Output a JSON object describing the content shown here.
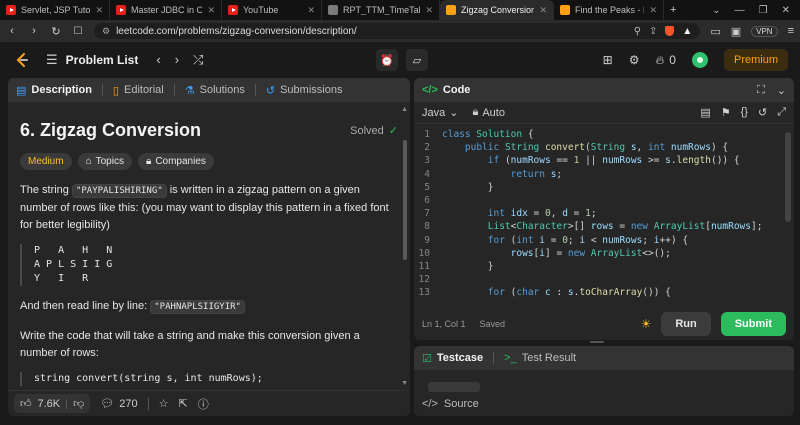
{
  "browser": {
    "tabs": [
      {
        "label": "Servlet, JSP Tutorial - YouTube",
        "favicon": "youtube-icon"
      },
      {
        "label": "Master JDBC in One Shot 🚀 : C",
        "favicon": "youtube-icon"
      },
      {
        "label": "YouTube",
        "favicon": "youtube-icon"
      },
      {
        "label": "RPT_TTM_TimeTableTran_Stude",
        "favicon": "web-icon"
      },
      {
        "label": "Zigzag Conversion - LeetC",
        "favicon": "leetcode-icon",
        "active": true
      },
      {
        "label": "Find the Peaks - LeetCode",
        "favicon": "leetcode-icon"
      }
    ],
    "new_tab": "+",
    "url": "leetcode.com/problems/zigzag-conversion/description/",
    "vpn_label": "VPN"
  },
  "header": {
    "problem_list_label": "Problem List",
    "streak_count": "0",
    "premium_label": "Premium"
  },
  "left_tabs": {
    "description": "Description",
    "editorial": "Editorial",
    "solutions": "Solutions",
    "submissions": "Submissions"
  },
  "problem": {
    "title": "6. Zigzag Conversion",
    "status": "Solved",
    "difficulty": "Medium",
    "topics_label": "Topics",
    "companies_label": "Companies",
    "para1_pre": "The string ",
    "para1_code": "\"PAYPALISHIRING\"",
    "para1_post": " is written in a zigzag pattern on a given number of rows like this: (you may want to display this pattern in a fixed font for better legibility)",
    "pattern": "P   A   H   N\nA P L S I I G\nY   I   R",
    "para2_pre": "And then read line by line: ",
    "para2_code": "\"PAHNAPLSIIGYIR\"",
    "para3": "Write the code that will take a string and make this conversion given a number of rows:",
    "signature": "string convert(string s, int numRows);"
  },
  "footer": {
    "likes": "7.6K",
    "comments": "270"
  },
  "code_panel": {
    "title": "Code",
    "language": "Java",
    "mode": "Auto",
    "cursor": "Ln 1, Col 1",
    "save_state": "Saved",
    "run_label": "Run",
    "submit_label": "Submit"
  },
  "code_lines": [
    {
      "n": "1",
      "indent": 0,
      "tokens": [
        [
          "kw",
          "class "
        ],
        [
          "ty",
          "Solution"
        ],
        [
          "",
          " {"
        ]
      ]
    },
    {
      "n": "2",
      "indent": 1,
      "tokens": [
        [
          "kw",
          "public "
        ],
        [
          "ty",
          "String "
        ],
        [
          "fn",
          "convert"
        ],
        [
          "",
          "("
        ],
        [
          "ty",
          "String "
        ],
        [
          "vr",
          "s"
        ],
        [
          "",
          ", "
        ],
        [
          "kw",
          "int "
        ],
        [
          "vr",
          "numRows"
        ],
        [
          "",
          ") {"
        ]
      ]
    },
    {
      "n": "3",
      "indent": 2,
      "tokens": [
        [
          "kw",
          "if "
        ],
        [
          "",
          "("
        ],
        [
          "vr",
          "numRows"
        ],
        [
          "",
          " == "
        ],
        [
          "nm",
          "1"
        ],
        [
          "",
          " || "
        ],
        [
          "vr",
          "numRows"
        ],
        [
          "",
          " >= "
        ],
        [
          "vr",
          "s"
        ],
        [
          "",
          "."
        ],
        [
          "fn",
          "length"
        ],
        [
          "",
          "()) {"
        ]
      ]
    },
    {
      "n": "4",
      "indent": 3,
      "tokens": [
        [
          "kw",
          "return "
        ],
        [
          "vr",
          "s"
        ],
        [
          "",
          ";"
        ]
      ]
    },
    {
      "n": "5",
      "indent": 2,
      "tokens": [
        [
          "",
          "}"
        ]
      ]
    },
    {
      "n": "6",
      "indent": 0,
      "tokens": []
    },
    {
      "n": "7",
      "indent": 2,
      "tokens": [
        [
          "kw",
          "int "
        ],
        [
          "vr",
          "idx"
        ],
        [
          "",
          " = "
        ],
        [
          "nm",
          "0"
        ],
        [
          "",
          ", "
        ],
        [
          "vr",
          "d"
        ],
        [
          "",
          " = "
        ],
        [
          "nm",
          "1"
        ],
        [
          "",
          ";"
        ]
      ]
    },
    {
      "n": "8",
      "indent": 2,
      "tokens": [
        [
          "ty",
          "List"
        ],
        [
          "",
          "<"
        ],
        [
          "ty",
          "Character"
        ],
        [
          "",
          ">[] "
        ],
        [
          "vr",
          "rows"
        ],
        [
          "",
          " = "
        ],
        [
          "kw",
          "new "
        ],
        [
          "ty",
          "ArrayList"
        ],
        [
          "",
          "["
        ],
        [
          "vr",
          "numRows"
        ],
        [
          "",
          "];"
        ]
      ]
    },
    {
      "n": "9",
      "indent": 2,
      "tokens": [
        [
          "kw",
          "for "
        ],
        [
          "",
          "("
        ],
        [
          "kw",
          "int "
        ],
        [
          "vr",
          "i"
        ],
        [
          "",
          " = "
        ],
        [
          "nm",
          "0"
        ],
        [
          "",
          "; "
        ],
        [
          "vr",
          "i"
        ],
        [
          "",
          " < "
        ],
        [
          "vr",
          "numRows"
        ],
        [
          "",
          "; "
        ],
        [
          "vr",
          "i"
        ],
        [
          "",
          "++) {"
        ]
      ]
    },
    {
      "n": "10",
      "indent": 3,
      "tokens": [
        [
          "vr",
          "rows"
        ],
        [
          "",
          "["
        ],
        [
          "vr",
          "i"
        ],
        [
          "",
          "] = "
        ],
        [
          "kw",
          "new "
        ],
        [
          "ty",
          "ArrayList"
        ],
        [
          "",
          "<>();"
        ]
      ]
    },
    {
      "n": "11",
      "indent": 2,
      "tokens": [
        [
          "",
          "}"
        ]
      ]
    },
    {
      "n": "12",
      "indent": 0,
      "tokens": []
    },
    {
      "n": "13",
      "indent": 2,
      "tokens": [
        [
          "kw",
          "for "
        ],
        [
          "",
          "("
        ],
        [
          "kw",
          "char "
        ],
        [
          "vr",
          "c"
        ],
        [
          "",
          " : "
        ],
        [
          "vr",
          "s"
        ],
        [
          "",
          "."
        ],
        [
          "fn",
          "toCharArray"
        ],
        [
          "",
          "()) {"
        ]
      ]
    }
  ],
  "test_panel": {
    "testcase_label": "Testcase",
    "result_label": "Test Result",
    "source_label": "Source"
  },
  "colors": {
    "accent": "#ffa116",
    "submit": "#2cbb5d",
    "medium": "#ffc01e"
  }
}
